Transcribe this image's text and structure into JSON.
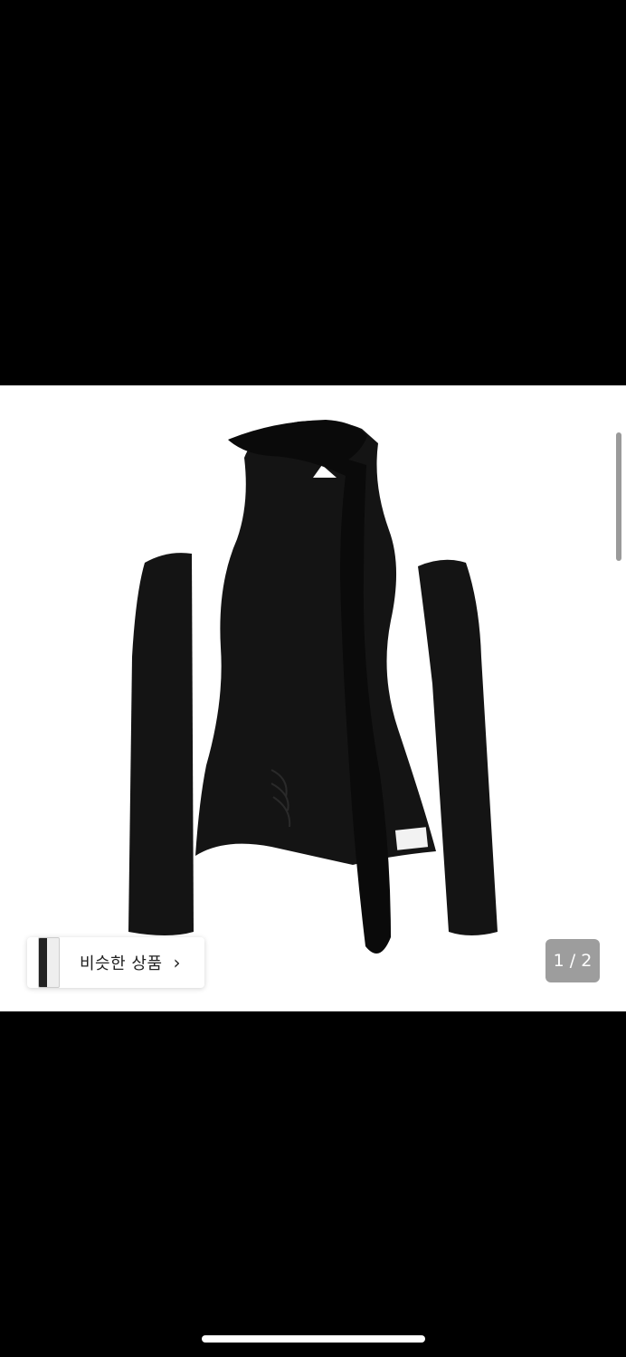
{
  "gallery": {
    "similar_products_label": "비슷한 상품",
    "chevron": "›",
    "page_counter": "1 / 2"
  },
  "icons": {
    "similar_chevron": "chevron-right-icon"
  },
  "colors": {
    "background": "#000000",
    "viewer_background": "#ffffff",
    "garment": "#141414",
    "counter_background": "#8c8c8c"
  }
}
